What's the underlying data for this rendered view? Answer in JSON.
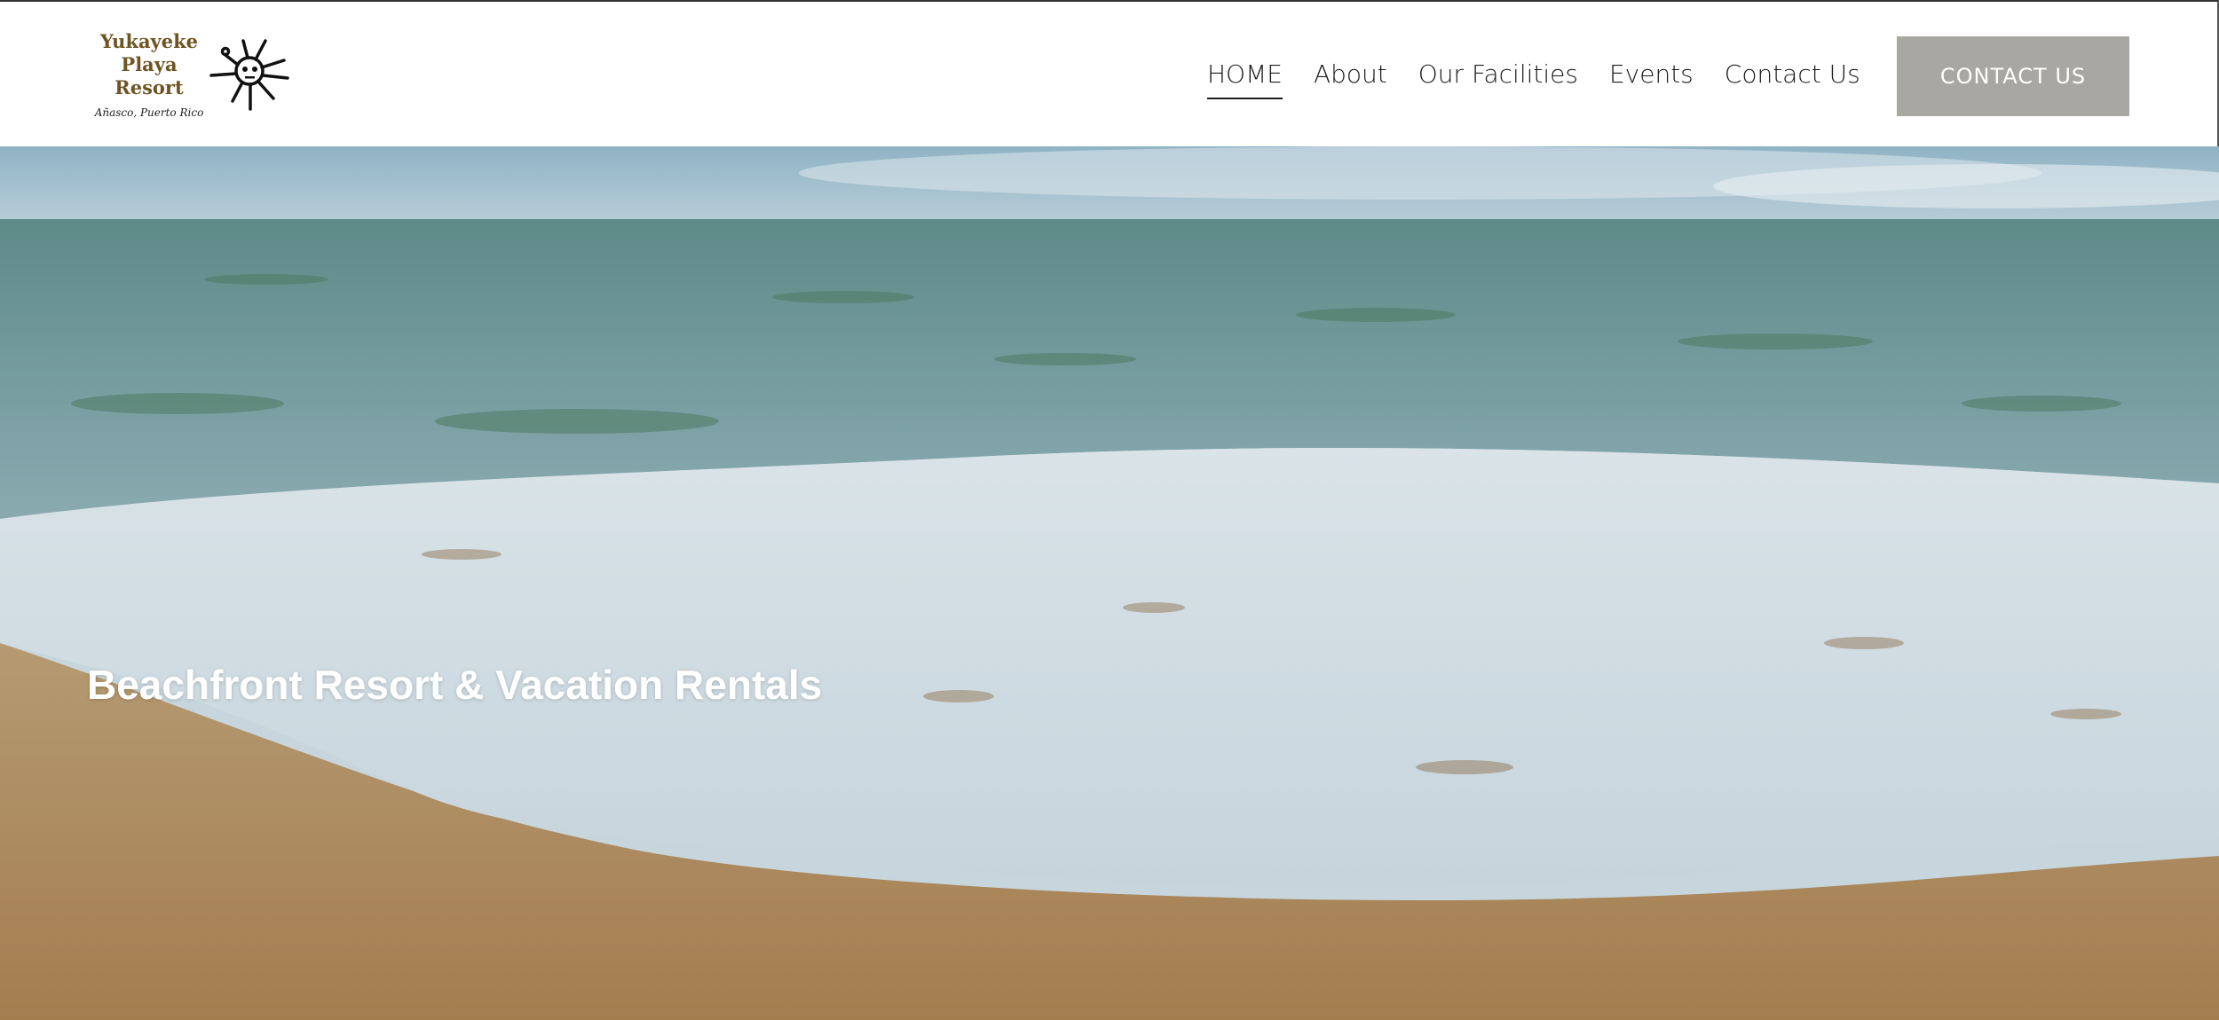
{
  "logo": {
    "line1": "Yukayeke",
    "line2": "Playa Resort",
    "line3": "Añasco, Puerto Rico",
    "icon": "taino-sun-icon",
    "text_color": "#6e5423"
  },
  "nav": {
    "items": [
      {
        "label": "HOME",
        "active": true
      },
      {
        "label": "About",
        "active": false
      },
      {
        "label": "Our Facilities",
        "active": false
      },
      {
        "label": "Events",
        "active": false
      },
      {
        "label": "Contact Us",
        "active": false
      }
    ]
  },
  "cta": {
    "label": "CONTACT US",
    "background": "#a9a7a1"
  },
  "hero": {
    "title": "Beachfront Resort & Vacation Rentals",
    "image": "ocean-beach-waves-photo"
  }
}
